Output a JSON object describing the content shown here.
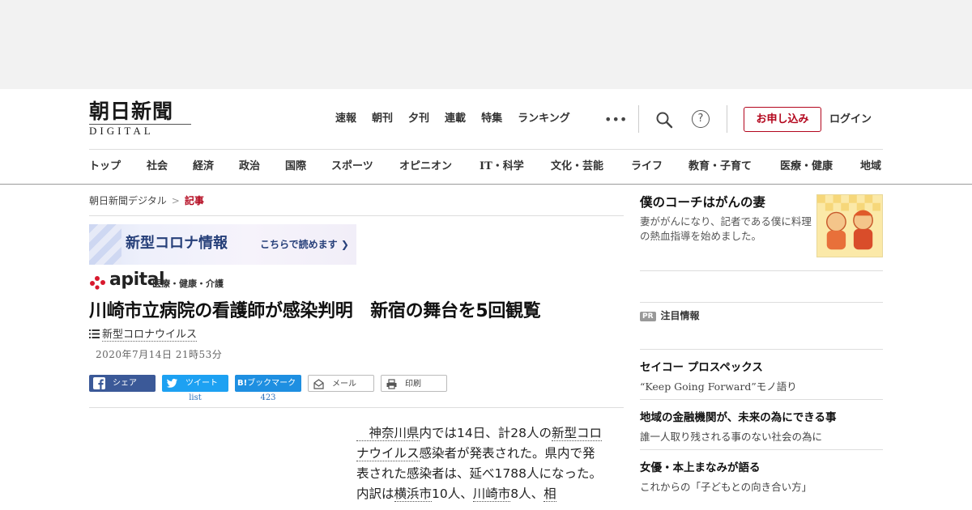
{
  "site": {
    "logo_jp": "朝日新聞",
    "logo_en": "DIGITAL"
  },
  "top_nav": [
    "速報",
    "朝刊",
    "夕刊",
    "連載",
    "特集",
    "ランキング"
  ],
  "header_actions": {
    "subscribe_label": "お申し込み",
    "login_label": "ログイン",
    "help_glyph": "?",
    "more_glyph": "•••"
  },
  "category_nav": [
    "トップ",
    "社会",
    "経済",
    "政治",
    "国際",
    "スポーツ",
    "オピニオン",
    "IT・科学",
    "文化・芸能",
    "ライフ",
    "教育・子育て",
    "医療・健康",
    "地域"
  ],
  "breadcrumb": {
    "home": "朝日新聞デジタル",
    "separator": ">",
    "current": "記事"
  },
  "corona_banner": {
    "title": "新型コロナ情報",
    "cta": "こちらで読めます ❯"
  },
  "apital": {
    "brand": "apital",
    "subtitle": "医療・健康・介護",
    "dot_color": "#d8192e"
  },
  "article": {
    "headline": "川崎市立病院の看護師が感染判明　新宿の舞台を5回観覧",
    "tag": "新型コロナウイルス",
    "date": "2020年7月14日 21時53分",
    "body": [
      {
        "t": "　神奈川県",
        "link": true
      },
      {
        "t": "内では14日、計28人の",
        "link": false
      },
      {
        "t": "新型コロナウイルス",
        "link": true
      },
      {
        "t": "感染者が発表された。県内で発表された感染者は、延べ1788人になった。内訳は",
        "link": false
      },
      {
        "t": "横浜市",
        "link": true
      },
      {
        "t": "10人、",
        "link": false
      },
      {
        "t": "川崎市",
        "link": true
      },
      {
        "t": "8人、",
        "link": false
      },
      {
        "t": "相",
        "link": true
      }
    ]
  },
  "share": {
    "facebook": "シェア",
    "twitter": "ツイート",
    "hatena": "ブックマーク",
    "hatena_mark": "B!",
    "mail": "メール",
    "print": "印刷",
    "twitter_count": "list",
    "hatena_count": "423"
  },
  "sidebar": {
    "promo": {
      "title": "僕のコーチはがんの妻",
      "desc": "妻ががんになり、記者である僕に料理の熱血指導を始めました。"
    },
    "pr_badge": "PR",
    "pr_heading": "注目情報",
    "items": [
      {
        "title": "セイコー プロスペックス",
        "desc": "“Keep Going Forward”モノ語り"
      },
      {
        "title": "地域の金融機関が、未来の為にできる事",
        "desc": "誰一人取り残される事のない社会の為に"
      },
      {
        "title": "女優・本上まなみが語る",
        "desc": "これからの「子どもとの向き合い方」"
      }
    ]
  },
  "colors": {
    "accent_red": "#b3061d",
    "facebook": "#3b5998",
    "twitter": "#1da1f2",
    "hatena": "#1e8fe1",
    "banner_text": "#27407a"
  }
}
